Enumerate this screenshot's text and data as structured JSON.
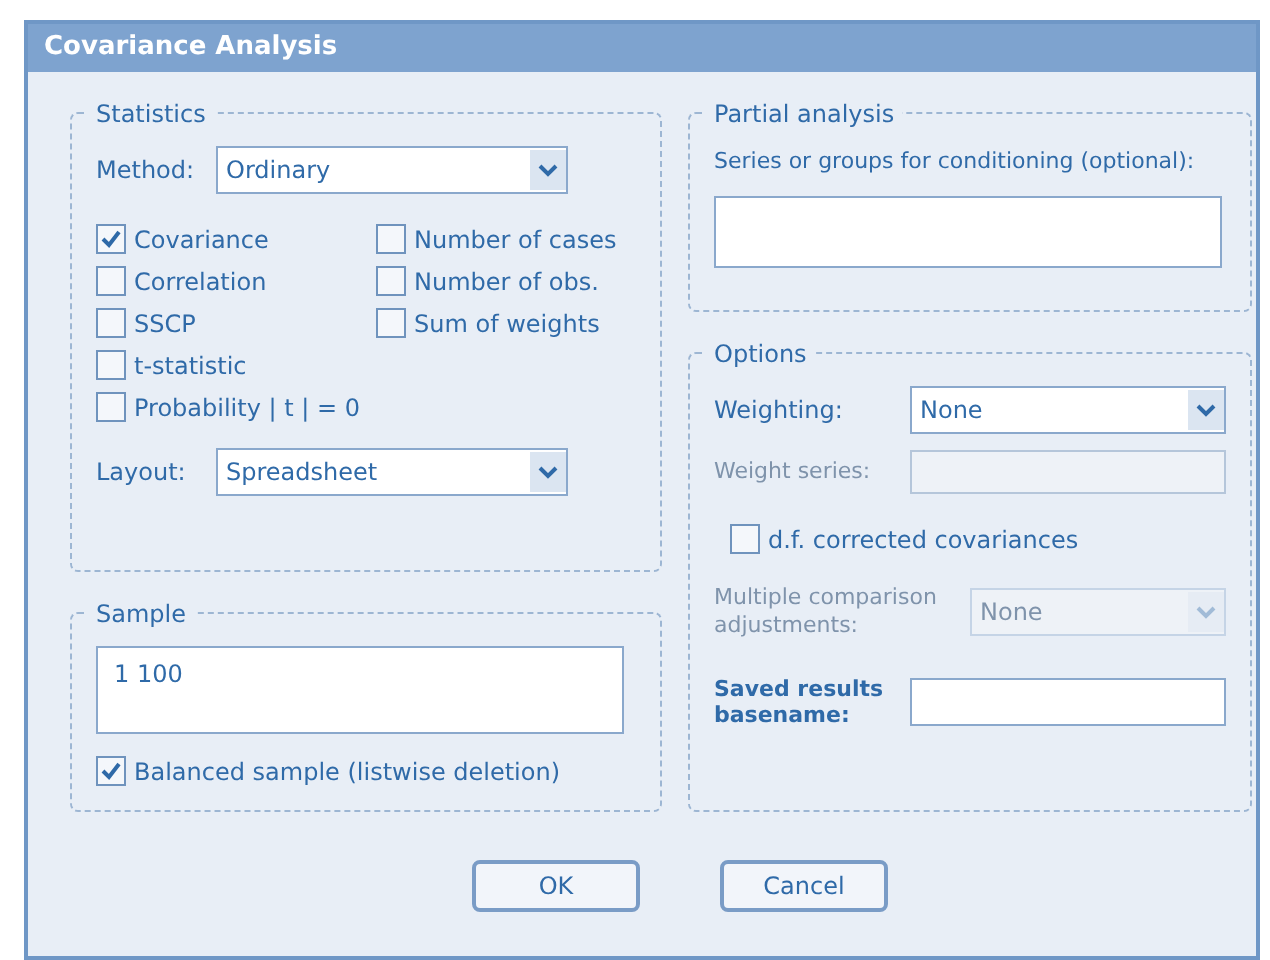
{
  "window": {
    "title": "Covariance Analysis"
  },
  "statistics": {
    "title": "Statistics",
    "method": {
      "label": "Method:",
      "value": "Ordinary"
    },
    "checkbox_columns": [
      [
        {
          "label": "Covariance",
          "checked": true
        },
        {
          "label": "Correlation",
          "checked": false
        },
        {
          "label": "SSCP",
          "checked": false
        },
        {
          "label": "t-statistic",
          "checked": false
        },
        {
          "label": "Probability | t | = 0",
          "checked": false
        }
      ],
      [
        {
          "label": "Number of cases",
          "checked": false
        },
        {
          "label": "Number of obs.",
          "checked": false
        },
        {
          "label": "Sum of weights",
          "checked": false
        }
      ]
    ],
    "layout": {
      "label": "Layout:",
      "value": "Spreadsheet"
    }
  },
  "sample": {
    "title": "Sample",
    "value": "1 100",
    "balanced": {
      "label": "Balanced sample (listwise deletion)",
      "checked": true
    }
  },
  "partial_analysis": {
    "title": "Partial analysis",
    "label": "Series or groups for conditioning (optional):"
  },
  "options": {
    "title": "Options",
    "weighting": {
      "label": "Weighting:",
      "value": "None",
      "disabled": false
    },
    "weight_series": {
      "label": "Weight series:",
      "disabled": true
    },
    "df_corrected": {
      "label": "d.f. corrected covariances",
      "checked": false
    },
    "multiple_comparison": {
      "label": "Multiple comparison adjustments:",
      "value": "None",
      "disabled": true
    },
    "saved_results": {
      "label": "Saved results basename:",
      "disabled": false
    }
  },
  "buttons": [
    "OK",
    "Cancel"
  ]
}
